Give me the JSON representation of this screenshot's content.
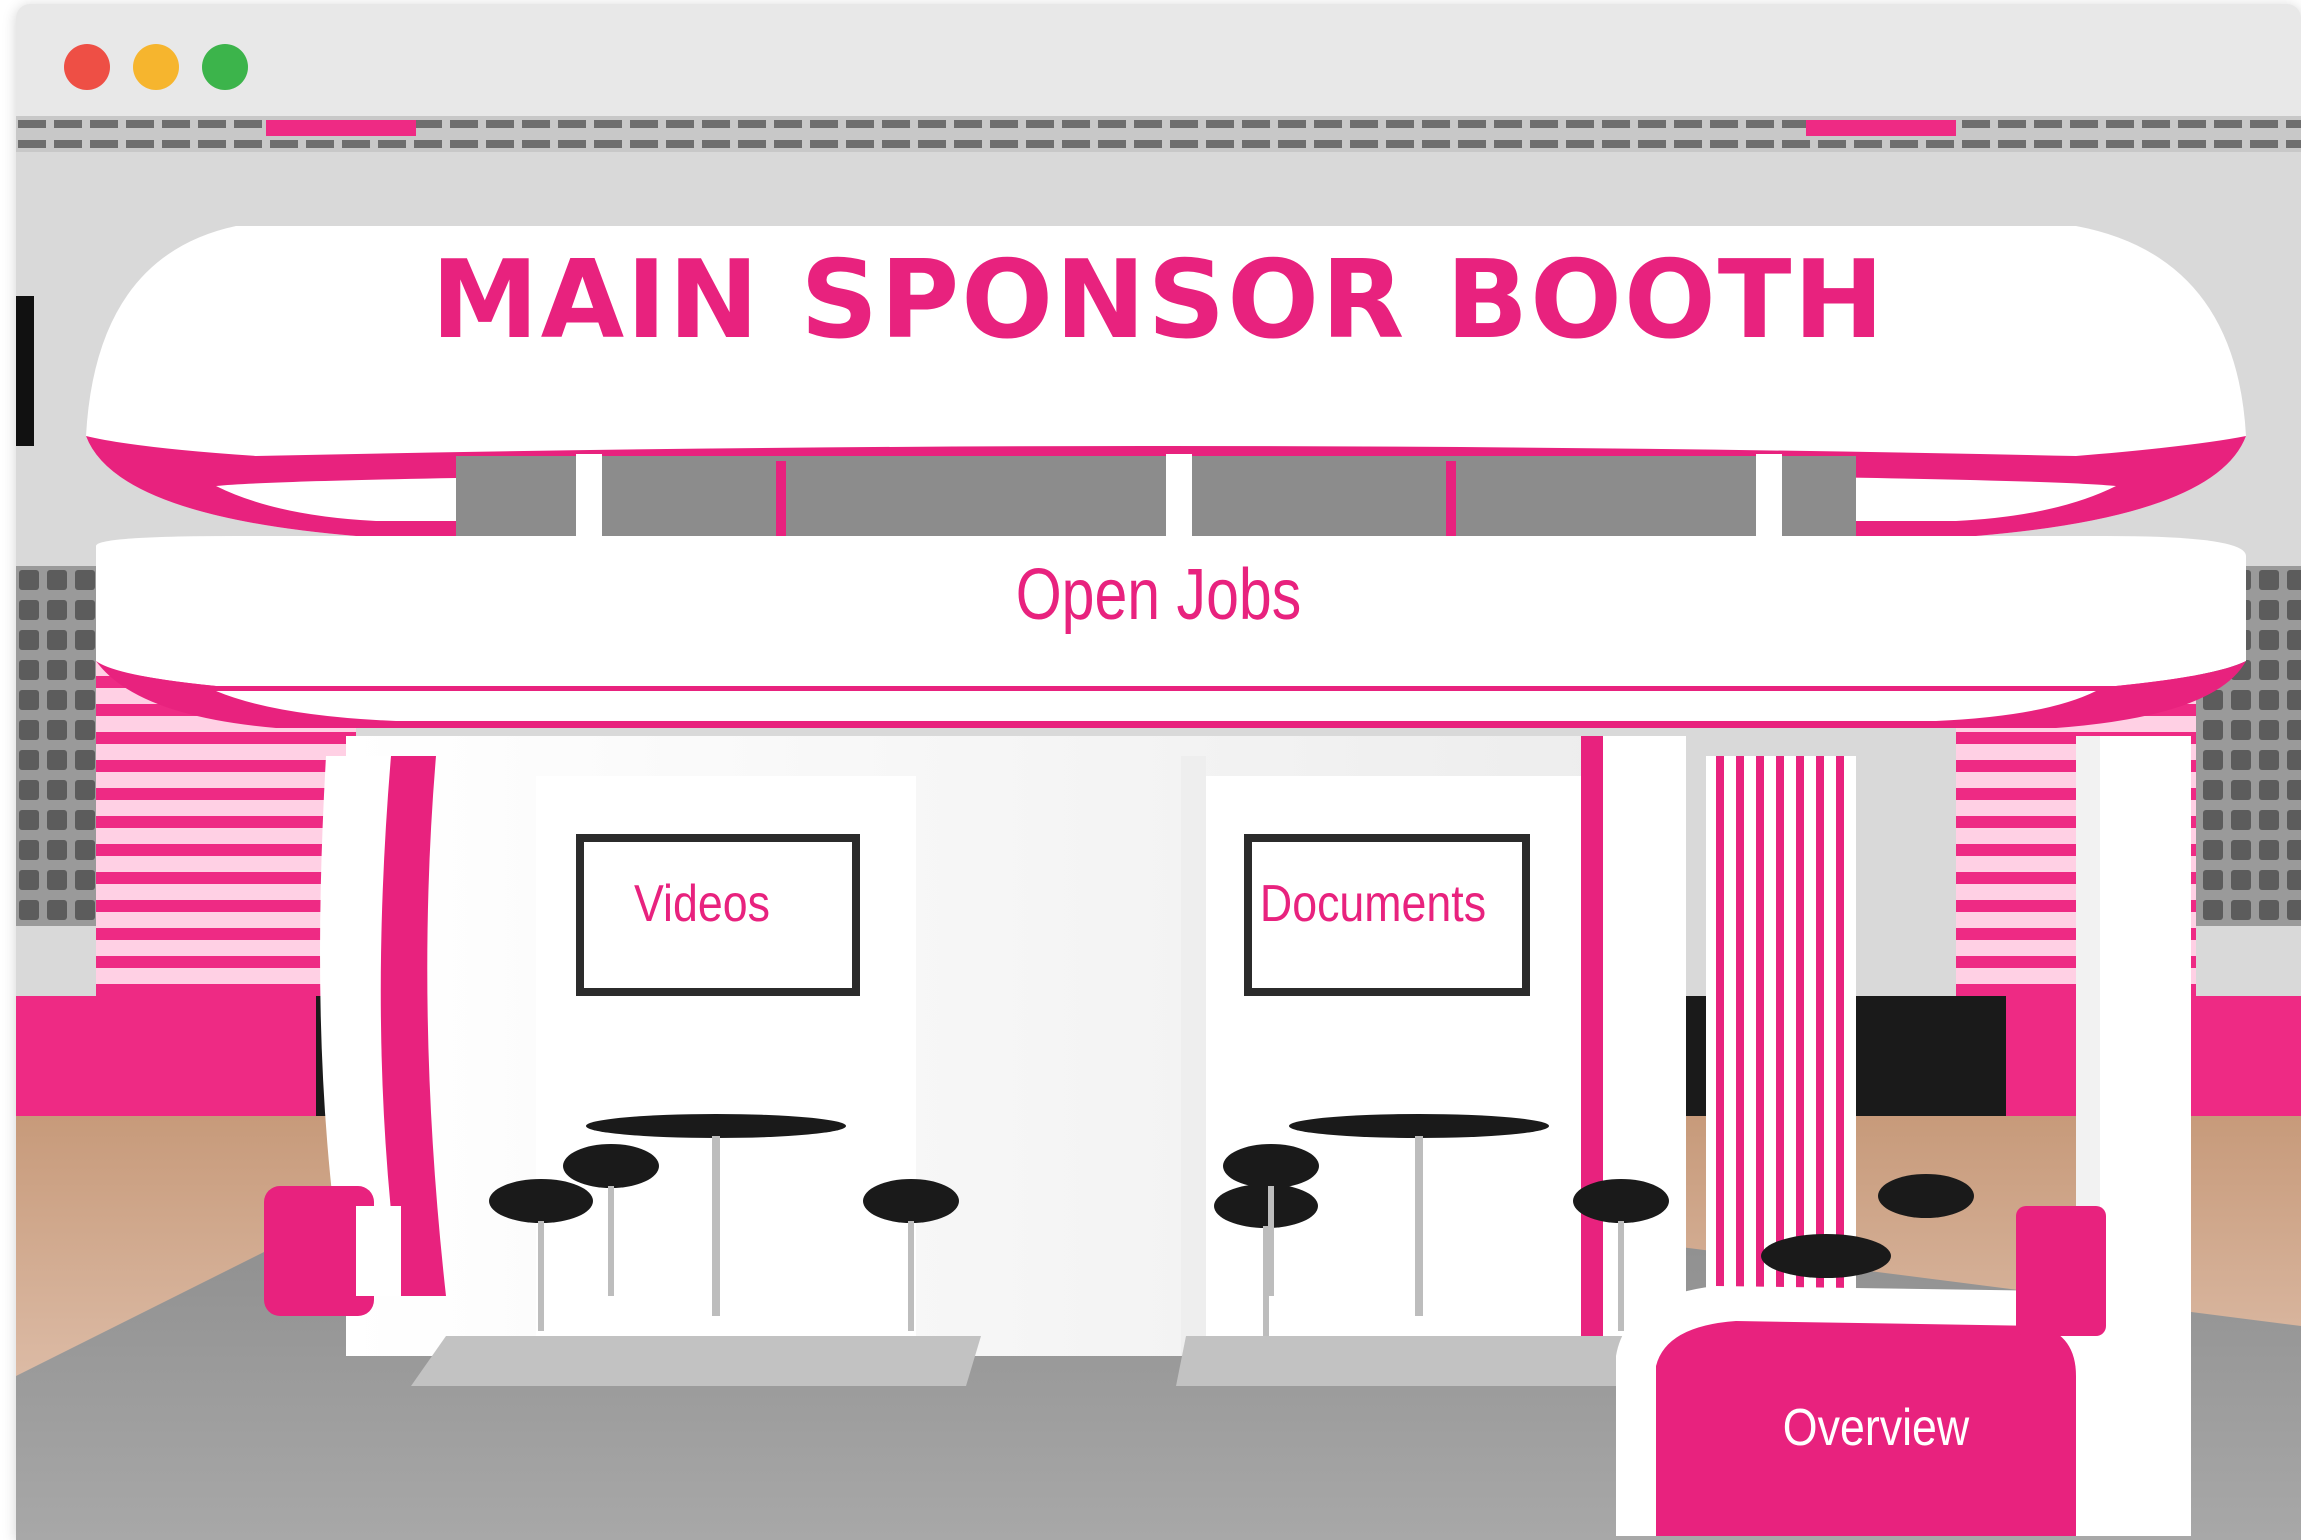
{
  "window": {
    "controls": [
      "close",
      "minimize",
      "maximize"
    ]
  },
  "booth": {
    "title": "MAIN SPONSOR BOOTH",
    "open_jobs_label": "Open Jobs",
    "videos_label": "Videos",
    "documents_label": "Documents",
    "overview_label": "Overview"
  },
  "colors": {
    "brand_magenta": "#e8227e",
    "titlebar": "#e8e8e8",
    "close": "#ee4f45",
    "minimize": "#f6b52e",
    "maximize": "#3cb44b"
  }
}
